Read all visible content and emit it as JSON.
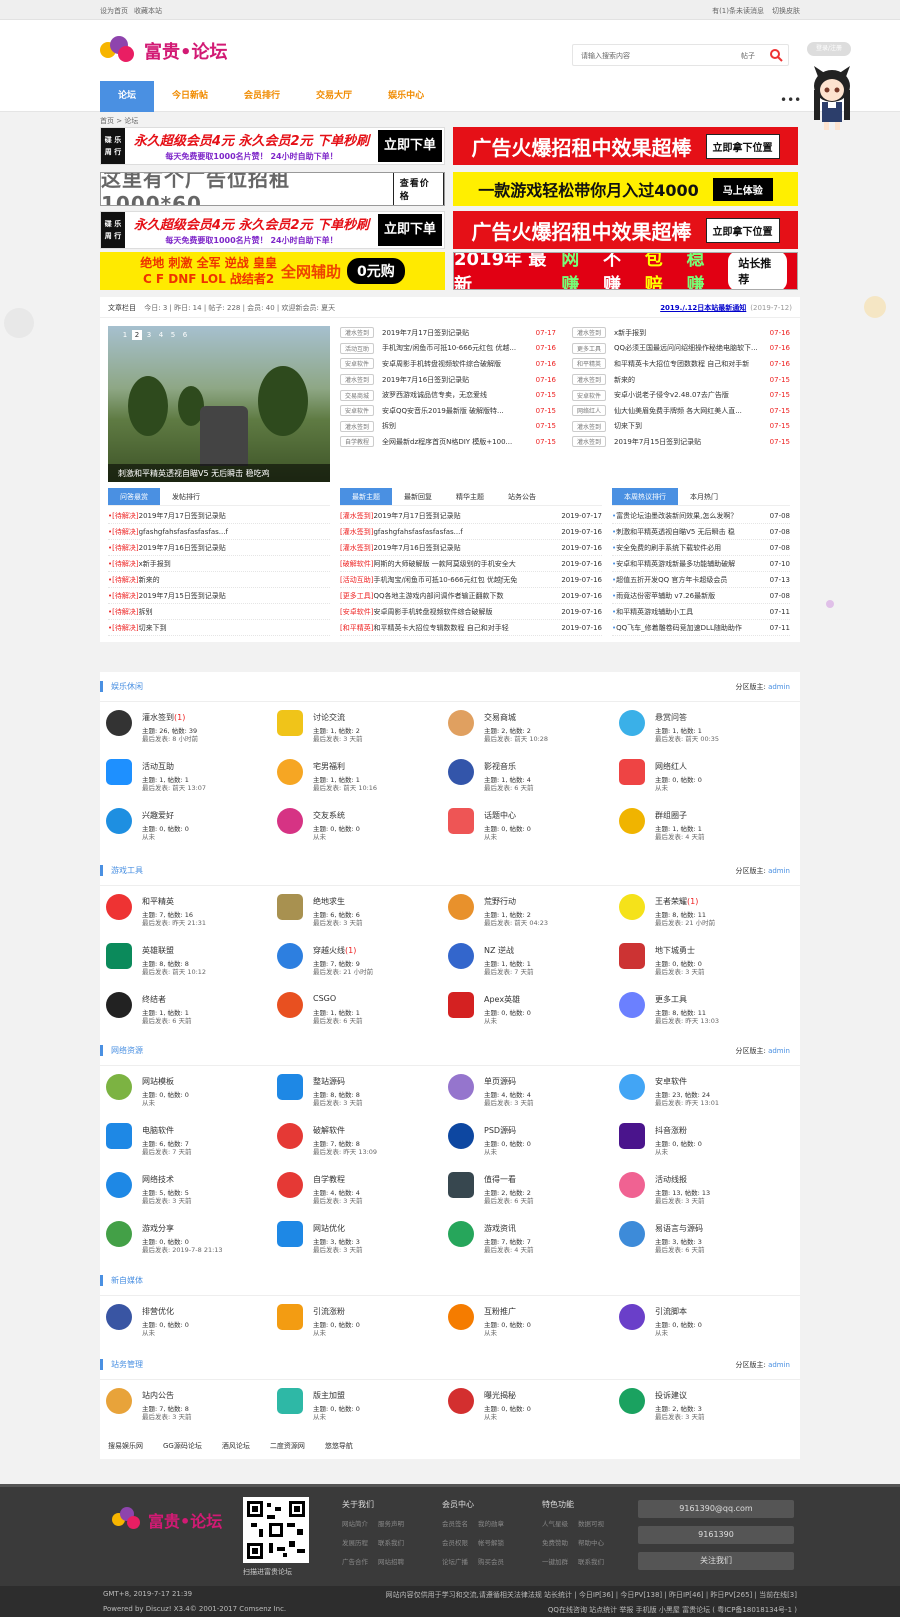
{
  "topbar": {
    "left": [
      "设为首页",
      "收藏本站"
    ],
    "right": [
      "有(1)条未读消息",
      "切换皮肤"
    ]
  },
  "brand": {
    "name": "富贵•论坛"
  },
  "search": {
    "placeholder": "请输入搜索内容",
    "type": "帖子"
  },
  "login": "登录/注册",
  "nav": [
    "论坛",
    "今日新帖",
    "会员排行",
    "交易大厅",
    "娱乐中心"
  ],
  "crumb": "首页 > 论坛",
  "ads": {
    "sale_k": "碟\n乐\n周\n行",
    "sale_a": "永久超级会员4元  永久会员2元  下单秒刷",
    "sale_b": "每天免费要取1000名片赞！ 24小时自助下单！",
    "sale_btn": "立即下单",
    "red1": "广告火爆招租中效果超棒",
    "red_btn": "立即拿下位置",
    "white": "这里有个广告位招租 1000*60",
    "white_btn": "查看价格",
    "yellow": "一款游戏轻松带你月入过4000",
    "yellow_btn": "马上体验",
    "combo_a": "绝地 刺激 全军 逆战 皇皇",
    "combo_b": "C F DNF LOL 战结者2",
    "combo_c": "全网辅助",
    "combo_d": "0元购",
    "y2019": [
      "2019年 最新",
      "网赚",
      "不赚",
      "包赔",
      "稳赚"
    ],
    "y2019_btn": "站长推荐"
  },
  "stats": {
    "label": "文章栏目",
    "today": "今日: 3",
    "yesterday": "昨日: 14",
    "posts": "帖子: 228",
    "members": "会员: 40",
    "welcome": "欢迎新会员: 夏天",
    "notice": "2019./.12日本站最新通知",
    "notice_date": "(2019-7-12)"
  },
  "slide": {
    "pages": [
      "1",
      "2",
      "3",
      "4",
      "5",
      "6"
    ],
    "caption": "刺激和平精英透视自瞄V5 无后瞬击 稳吃鸡"
  },
  "topics_left": [
    {
      "tag": "灌水签到",
      "t": "2019年7月17日签到记录贴",
      "d": "07-17"
    },
    {
      "tag": "活动互助",
      "t": "手机淘宝/闲鱼币可抵10-666元红包 优越...",
      "d": "07-16"
    },
    {
      "tag": "安卓软件",
      "t": "安卓周影手机转盘视频软件综合破解版",
      "d": "07-16"
    },
    {
      "tag": "灌水签到",
      "t": "2019年7月16日签到记录贴",
      "d": "07-16"
    },
    {
      "tag": "交易商城",
      "t": "波罗西游戏诚品信专卖，无恋爱线",
      "d": "07-15"
    },
    {
      "tag": "安卓软件",
      "t": "安卓QQ安音乐2019最新版 破解版特...",
      "d": "07-15"
    },
    {
      "tag": "灌水签到",
      "t": "拆别",
      "d": "07-15"
    },
    {
      "tag": "自学教程",
      "t": "全网最新dz程序首页N格DIY 模版+100...",
      "d": "07-15"
    }
  ],
  "topics_right": [
    {
      "tag": "灌水签到",
      "t": "x新手报到",
      "d": "07-16"
    },
    {
      "tag": "更多工具",
      "t": "QQ必须王国最远问问绍细操作秘绝电脑软下...",
      "d": "07-16"
    },
    {
      "tag": "和平精英",
      "t": "和平精英卡大招位专团数数程 自己和对手新",
      "d": "07-16"
    },
    {
      "tag": "灌水签到",
      "t": "新来的",
      "d": "07-15"
    },
    {
      "tag": "安卓软件",
      "t": "安卓小说老子侵令v2.48.07去广告版",
      "d": "07-15"
    },
    {
      "tag": "网络红人",
      "t": "仙大仙美眉免费手牌频 各大网红美人直...",
      "d": "07-15"
    },
    {
      "tag": "灌水签到",
      "t": "切来下到",
      "d": "07-15"
    },
    {
      "tag": "灌水签到",
      "t": "2019年7月15日签到记录贴",
      "d": "07-15"
    }
  ],
  "tabs_a": [
    "问答悬赏",
    "发帖排行"
  ],
  "tabs_b": [
    "最新主题",
    "最新回复",
    "精华主题",
    "站务公告"
  ],
  "tabs_c": [
    "本周热议排行",
    "本月热门"
  ],
  "qa": [
    {
      "s": "[待解决]",
      "t": "2019年7月17日签到记录贴"
    },
    {
      "s": "[待解决]",
      "t": "gfashgfahsfasfasfasfas...f"
    },
    {
      "s": "[待解决]",
      "t": "2019年7月16日签到记录贴"
    },
    {
      "s": "[待解决]",
      "t": "x新手报到"
    },
    {
      "s": "[待解决]",
      "t": "新来的"
    },
    {
      "s": "[待解决]",
      "t": "2019年7月15日签到记录贴"
    },
    {
      "s": "[待解决]",
      "t": "拆别"
    },
    {
      "s": "[待解决]",
      "t": "切来下到"
    }
  ],
  "latest": [
    {
      "c": "[灌水签到]",
      "t": "2019年7月17日签到记录贴",
      "d": "2019-07-17"
    },
    {
      "c": "[灌水签到]",
      "t": "gfashgfahsfasfasfasfas...f",
      "d": "2019-07-16"
    },
    {
      "c": "[灌水签到]",
      "t": "2019年7月16日签到记录贴",
      "d": "2019-07-16"
    },
    {
      "c": "[破解软件]",
      "t": "阿斯的大师破解版 一款阿莫级别的手机安全大",
      "d": "2019-07-16"
    },
    {
      "c": "[活动互助]",
      "t": "手机淘宝/闲鱼币可抵10-666元红包 优越ƒ无免",
      "d": "2019-07-16"
    },
    {
      "c": "[更多工具]",
      "t": "QQ各地主游戏内部问调作者输正翻款下数",
      "d": "2019-07-16"
    },
    {
      "c": "[安卓软件]",
      "t": "安卓周影手机转盘视频软件综合破解版",
      "d": "2019-07-16"
    },
    {
      "c": "[和平精英]",
      "t": "和平精英卡大招位专辑数数程 自己和对手轻",
      "d": "2019-07-16"
    }
  ],
  "hot": [
    {
      "t": "富贵论坛油墨改装新间效果,怎么发啊？",
      "d": "07-08"
    },
    {
      "t": "刺激和平精英透视自瞄V5 无后瞬击 稳",
      "d": "07-08"
    },
    {
      "t": "安全免费的刷手系统下载软件必用",
      "d": "07-08"
    },
    {
      "t": "安卓和平精英游戏新最多功能辅助破解",
      "d": "07-10"
    },
    {
      "t": "超值五折开发QQ 官方年卡超级会员",
      "d": "07-13"
    },
    {
      "t": "雨竟达份密苹辅助 v7.26最新版",
      "d": "07-08"
    },
    {
      "t": "和平精英游戏辅助小工具",
      "d": "07-11"
    },
    {
      "t": "QQ飞车_修着雕卷码竞加速DLL随助助作",
      "d": "07-11"
    }
  ],
  "sections": [
    {
      "title": "娱乐休闲",
      "mod": "分区版主: ",
      "admin": "admin",
      "forums": [
        {
          "n": "灌水签到",
          "new": "(1)",
          "s1": "主题: 26, 帖数: 39",
          "s2": "最后发表: 8 小时前",
          "c": "#333",
          "i": "crown"
        },
        {
          "n": "讨论交流",
          "new": "",
          "s1": "主题: 1, 帖数: 2",
          "s2": "最后发表: 3 天前",
          "c": "#f0c419",
          "i": "chat"
        },
        {
          "n": "交易商城",
          "new": "",
          "s1": "主题: 2, 帖数: 2",
          "s2": "最后发表: 前天 10:28",
          "c": "#e0a060",
          "i": "shop"
        },
        {
          "n": "悬赏问答",
          "new": "",
          "s1": "主题: 1, 帖数: 1",
          "s2": "最后发表: 前天 00:35",
          "c": "#3ab0e8",
          "i": "reward"
        },
        {
          "n": "活动互助",
          "new": "",
          "s1": "主题: 1, 帖数: 1",
          "s2": "最后发表: 前天 13:07",
          "c": "#1e90ff",
          "i": "heart"
        },
        {
          "n": "宅男福利",
          "new": "",
          "s1": "主题: 1, 帖数: 1",
          "s2": "最后发表: 前天 10:16",
          "c": "#f6a623",
          "i": "gift"
        },
        {
          "n": "影视音乐",
          "new": "",
          "s1": "主题: 1, 帖数: 4",
          "s2": "最后发表: 6 天前",
          "c": "#3355aa",
          "i": "film"
        },
        {
          "n": "网络红人",
          "new": "",
          "s1": "主题: 0, 帖数: 0",
          "s2": "从未",
          "c": "#e44",
          "i": "red"
        },
        {
          "n": "兴趣爱好",
          "new": "",
          "s1": "主题: 0, 帖数: 0",
          "s2": "从未",
          "c": "#1e8fe1",
          "i": "star"
        },
        {
          "n": "交友系统",
          "new": "",
          "s1": "主题: 0, 帖数: 0",
          "s2": "从未",
          "c": "#d63384",
          "i": "friend"
        },
        {
          "n": "话题中心",
          "new": "",
          "s1": "主题: 0, 帖数: 0",
          "s2": "从未",
          "c": "#e55",
          "i": "topic"
        },
        {
          "n": "群组圈子",
          "new": "",
          "s1": "主题: 1, 帖数: 1",
          "s2": "最后发表: 4 天前",
          "c": "#f0b400",
          "i": "group"
        }
      ]
    },
    {
      "title": "游戏工具",
      "mod": "分区版主: ",
      "admin": "admin",
      "forums": [
        {
          "n": "和平精英",
          "new": "",
          "s1": "主题: 7, 帖数: 16",
          "s2": "最后发表: 昨天 21:31",
          "c": "#e33",
          "i": "peace"
        },
        {
          "n": "绝地求生",
          "new": "",
          "s1": "主题: 6, 帖数: 6",
          "s2": "最后发表: 3 天前",
          "c": "#a89150",
          "i": "pubg"
        },
        {
          "n": "荒野行动",
          "new": "",
          "s1": "主题: 1, 帖数: 2",
          "s2": "最后发表: 前天 04:23",
          "c": "#e8912c",
          "i": "wild"
        },
        {
          "n": "王者荣耀",
          "new": "(1)",
          "s1": "主题: 8, 帖数: 11",
          "s2": "最后发表: 21 小时前",
          "c": "#f5e21a",
          "i": "king"
        },
        {
          "n": "英雄联盟",
          "new": "",
          "s1": "主题: 8, 帖数: 8",
          "s2": "最后发表: 前天 10:12",
          "c": "#0b8a5b",
          "i": "lol"
        },
        {
          "n": "穿越火线",
          "new": "(1)",
          "s1": "主题: 7, 帖数: 9",
          "s2": "最后发表: 21 小时前",
          "c": "#2d7fe0",
          "i": "cf"
        },
        {
          "n": "NZ 逆战",
          "new": "",
          "s1": "主题: 1, 帖数: 1",
          "s2": "最后发表: 7 天前",
          "c": "#3366cc",
          "i": "nz"
        },
        {
          "n": "地下城勇士",
          "new": "",
          "s1": "主题: 0, 帖数: 0",
          "s2": "最后发表: 3 天前",
          "c": "#c33",
          "i": "dnf"
        },
        {
          "n": "终结者",
          "new": "",
          "s1": "主题: 1, 帖数: 1",
          "s2": "最后发表: 6 天前",
          "c": "#222",
          "i": "term"
        },
        {
          "n": "CSGO",
          "new": "",
          "s1": "主题: 1, 帖数: 1",
          "s2": "最后发表: 6 天前",
          "c": "#e85020",
          "i": "csgo"
        },
        {
          "n": "Apex英雄",
          "new": "",
          "s1": "主题: 0, 帖数: 0",
          "s2": "从未",
          "c": "#d42121",
          "i": "apex"
        },
        {
          "n": "更多工具",
          "new": "",
          "s1": "主题: 8, 帖数: 11",
          "s2": "最后发表: 昨天 13:03",
          "c": "#6b80ff",
          "i": "tools"
        }
      ]
    },
    {
      "title": "网络资源",
      "mod": "分区版主: ",
      "admin": "admin",
      "forums": [
        {
          "n": "网站模板",
          "new": "",
          "s1": "主题: 0, 帖数: 0",
          "s2": "从未",
          "c": "#7cb342",
          "i": "tpl"
        },
        {
          "n": "整站源码",
          "new": "",
          "s1": "主题: 8, 帖数: 8",
          "s2": "最后发表: 3 天前",
          "c": "#1e88e5",
          "i": "globe"
        },
        {
          "n": "单页源码",
          "new": "",
          "s1": "主题: 4, 帖数: 4",
          "s2": "最后发表: 3 天前",
          "c": "#9575cd",
          "i": "page"
        },
        {
          "n": "安卓软件",
          "new": "",
          "s1": "主题: 23, 帖数: 24",
          "s2": "最后发表: 昨天 13:01",
          "c": "#42a5f5",
          "i": "android"
        },
        {
          "n": "电脑软件",
          "new": "",
          "s1": "主题: 6, 帖数: 7",
          "s2": "最后发表: 7 天前",
          "c": "#1e88e5",
          "i": "pc"
        },
        {
          "n": "破解软件",
          "new": "",
          "s1": "主题: 7, 帖数: 8",
          "s2": "最后发表: 昨天 13:09",
          "c": "#e53935",
          "i": "crack"
        },
        {
          "n": "PSD源码",
          "new": "",
          "s1": "主题: 0, 帖数: 0",
          "s2": "从未",
          "c": "#0d47a1",
          "i": "ps"
        },
        {
          "n": "抖音涨粉",
          "new": "",
          "s1": "主题: 0, 帖数: 0",
          "s2": "从未",
          "c": "#4a148c",
          "i": "tiktok"
        },
        {
          "n": "网络技术",
          "new": "",
          "s1": "主题: 5, 帖数: 5",
          "s2": "最后发表: 3 天前",
          "c": "#1e88e5",
          "i": "tech"
        },
        {
          "n": "自学教程",
          "new": "",
          "s1": "主题: 4, 帖数: 4",
          "s2": "最后发表: 3 天前",
          "c": "#e53935",
          "i": "book"
        },
        {
          "n": "值得一看",
          "new": "",
          "s1": "主题: 2, 帖数: 2",
          "s2": "最后发表: 6 天前",
          "c": "#37474f",
          "i": "eye"
        },
        {
          "n": "活动线报",
          "new": "",
          "s1": "主题: 13, 帖数: 13",
          "s2": "最后发表: 3 天前",
          "c": "#f06292",
          "i": "horn"
        },
        {
          "n": "游戏分享",
          "new": "",
          "s1": "主题: 0, 帖数: 0",
          "s2": "最后发表: 2019-7-8 21:13",
          "c": "#43a047",
          "i": "game"
        },
        {
          "n": "网站优化",
          "new": "",
          "s1": "主题: 3, 帖数: 3",
          "s2": "最后发表: 3 天前",
          "c": "#1e88e5",
          "i": "seo"
        },
        {
          "n": "游戏资讯",
          "new": "",
          "s1": "主题: 7, 帖数: 7",
          "s2": "最后发表: 4 天前",
          "c": "#26a65b",
          "i": "news"
        },
        {
          "n": "易语言与源码",
          "new": "",
          "s1": "主题: 3, 帖数: 3",
          "s2": "最后发表: 6 天前",
          "c": "#3d8bd9",
          "i": "easy"
        }
      ]
    },
    {
      "title": "新自媒体",
      "mod": "",
      "admin": "",
      "forums": [
        {
          "n": "排营优化",
          "new": "",
          "s1": "主题: 0, 帖数: 0",
          "s2": "从未",
          "c": "#3955a3",
          "i": "chart"
        },
        {
          "n": "引流涨粉",
          "new": "",
          "s1": "主题: 0, 帖数: 0",
          "s2": "从未",
          "c": "#f39c12",
          "i": "share"
        },
        {
          "n": "互粉推广",
          "new": "",
          "s1": "主题: 0, 帖数: 0",
          "s2": "从未",
          "c": "#f57c00",
          "i": "swap"
        },
        {
          "n": "引流脚本",
          "new": "",
          "s1": "主题: 0, 帖数: 0",
          "s2": "从未",
          "c": "#6a3fc9",
          "i": "code"
        }
      ]
    },
    {
      "title": "站务管理",
      "mod": "分区版主: ",
      "admin": "admin",
      "forums": [
        {
          "n": "站内公告",
          "new": "",
          "s1": "主题: 7, 帖数: 8",
          "s2": "最后发表: 3 天前",
          "c": "#e8a33a",
          "i": "notice"
        },
        {
          "n": "版主加盟",
          "new": "",
          "s1": "主题: 0, 帖数: 0",
          "s2": "从未",
          "c": "#2eb8a6",
          "i": "join"
        },
        {
          "n": "曝光揭秘",
          "new": "",
          "s1": "主题: 0, 帖数: 0",
          "s2": "从未",
          "c": "#d32f2f",
          "i": "expose"
        },
        {
          "n": "投诉建议",
          "new": "",
          "s1": "主题: 2, 帖数: 3",
          "s2": "最后发表: 3 天前",
          "c": "#1aa260",
          "i": "complain"
        }
      ]
    }
  ],
  "friend_links": [
    "搜易娱乐网",
    "GG源码论坛",
    "酒风论坛",
    "二度资源网",
    "悠悠导航"
  ],
  "footer": {
    "qrcap": "扫描进富贵论坛",
    "c1": {
      "h": "关于我们",
      "r": [
        [
          "网站简介",
          "服务声明"
        ],
        [
          "发展历程",
          "联系我们"
        ],
        [
          "广告合作",
          "网站招聘"
        ]
      ]
    },
    "c2": {
      "h": "会员中心",
      "r": [
        [
          "会员签名",
          "我的勋章"
        ],
        [
          "会员权限",
          "帐号解锁"
        ],
        [
          "论坛广播",
          "购买会员"
        ]
      ]
    },
    "c3": {
      "h": "特色功能",
      "r": [
        [
          "人气星级",
          "数据可视"
        ],
        [
          "免费赞助",
          "帮助中心"
        ],
        [
          "一键加群",
          "联系我们"
        ]
      ]
    },
    "email": "9161390@qq.com",
    "qq": "9161390",
    "wx": "关注我们",
    "time": "GMT+8, 2019-7-17 21:39",
    "power": "Powered by Discuz! X3.4© 2001-2017 Comsenz Inc.",
    "stat_line": "网站内容仅供用于学习和交流,请遵循相关法律法规 站长统计 | 今日IP[36] | 今日PV[138] | 昨日IP[46] | 昨日PV[265] | 当前在线[3]",
    "bottom_line": "QQ在线咨询  站点统计  举报  手机版  小黑屋  富贵论坛 ( 粤ICP备18018134号-1 )"
  }
}
